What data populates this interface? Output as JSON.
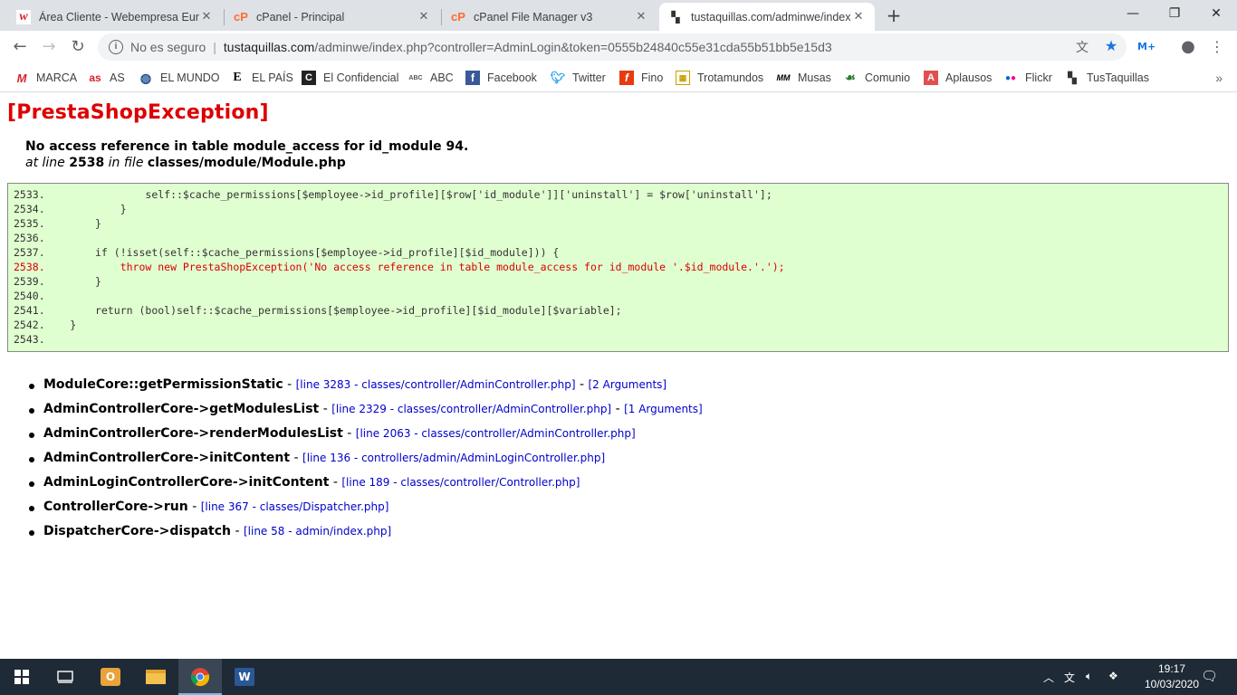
{
  "tabs": [
    {
      "title": "Área Cliente - Webempresa Europa",
      "icon": "webempresa-icon",
      "active": false
    },
    {
      "title": "cPanel - Principal",
      "icon": "cpanel-icon",
      "active": false
    },
    {
      "title": "cPanel File Manager v3",
      "icon": "cpanel-icon",
      "active": false
    },
    {
      "title": "tustaquillas.com/adminwe/index.php",
      "icon": "tustaquillas-icon",
      "active": true
    }
  ],
  "window_controls": {
    "minimize": "—",
    "restore": "❐",
    "close": "✕"
  },
  "address_bar": {
    "security_label": "No es seguro",
    "host": "tustaquillas.com",
    "path": "/adminwe/index.php?controller=AdminLogin&token=0555b24840c55e31cda55b51bb5e15d3"
  },
  "bookmarks": [
    {
      "label": "MARCA",
      "icon": "marca-icon",
      "color": "#d8232a"
    },
    {
      "label": "AS",
      "icon": "as-icon",
      "color": "#d8232a"
    },
    {
      "label": "EL MUNDO",
      "icon": "globe-icon",
      "color": "#1a4d8f"
    },
    {
      "label": "EL PAÍS",
      "icon": "elpais-icon",
      "color": "#000000"
    },
    {
      "label": "El Confidencial",
      "icon": "confidencial-icon",
      "color": "#222222"
    },
    {
      "label": "ABC",
      "icon": "abc-icon",
      "color": "#555555"
    },
    {
      "label": "Facebook",
      "icon": "facebook-icon",
      "color": "#3b5998"
    },
    {
      "label": "Twitter",
      "icon": "twitter-icon",
      "color": "#1da1f2"
    },
    {
      "label": "Fino",
      "icon": "fino-icon",
      "color": "#e83a10"
    },
    {
      "label": "Trotamundos",
      "icon": "trotamundos-icon",
      "color": "#c8a000"
    },
    {
      "label": "Musas",
      "icon": "musas-icon",
      "color": "#000000"
    },
    {
      "label": "Comunio",
      "icon": "comunio-icon",
      "color": "#2e7d32"
    },
    {
      "label": "Aplausos",
      "icon": "aplausos-icon",
      "color": "#d33"
    },
    {
      "label": "Flickr",
      "icon": "flickr-icon",
      "color": "#0063dc"
    },
    {
      "label": "TusTaquillas",
      "icon": "tustaquillas-icon",
      "color": "#333333"
    }
  ],
  "exception": {
    "title": "[PrestaShopException]",
    "message": "No access reference in table module_access for id_module 94.",
    "at_line_label": "at line",
    "line": "2538",
    "in_file_label": "in file",
    "file": "classes/module/Module.php"
  },
  "code_lines": [
    {
      "text": "2533.                self::$cache_permissions[$employee->id_profile][$row['id_module']]['uninstall'] = $row['uninstall'];",
      "error": false
    },
    {
      "text": "2534.            }",
      "error": false
    },
    {
      "text": "2535.        }",
      "error": false
    },
    {
      "text": "2536.",
      "error": false
    },
    {
      "text": "2537.        if (!isset(self::$cache_permissions[$employee->id_profile][$id_module])) {",
      "error": false
    },
    {
      "text": "2538.            throw new PrestaShopException('No access reference in table module_access for id_module '.$id_module.'.');",
      "error": true
    },
    {
      "text": "2539.        }",
      "error": false
    },
    {
      "text": "2540.",
      "error": false
    },
    {
      "text": "2541.        return (bool)self::$cache_permissions[$employee->id_profile][$id_module][$variable];",
      "error": false
    },
    {
      "text": "2542.    }",
      "error": false
    },
    {
      "text": "2543.",
      "error": false
    }
  ],
  "trace": [
    {
      "call": "ModuleCore::getPermissionStatic",
      "loc": "[line 3283 - classes/controller/AdminController.php]",
      "args": "[2 Arguments]"
    },
    {
      "call": "AdminControllerCore->getModulesList",
      "loc": "[line 2329 - classes/controller/AdminController.php]",
      "args": "[1 Arguments]"
    },
    {
      "call": "AdminControllerCore->renderModulesList",
      "loc": "[line 2063 - classes/controller/AdminController.php]",
      "args": ""
    },
    {
      "call": "AdminControllerCore->initContent",
      "loc": "[line 136 - controllers/admin/AdminLoginController.php]",
      "args": ""
    },
    {
      "call": "AdminLoginControllerCore->initContent",
      "loc": "[line 189 - classes/controller/Controller.php]",
      "args": ""
    },
    {
      "call": "ControllerCore->run",
      "loc": "[line 367 - classes/Dispatcher.php]",
      "args": ""
    },
    {
      "call": "DispatcherCore->dispatch",
      "loc": "[line 58 - admin/index.php]",
      "args": ""
    }
  ],
  "clock": {
    "time": "19:17",
    "date": "10/03/2020"
  }
}
